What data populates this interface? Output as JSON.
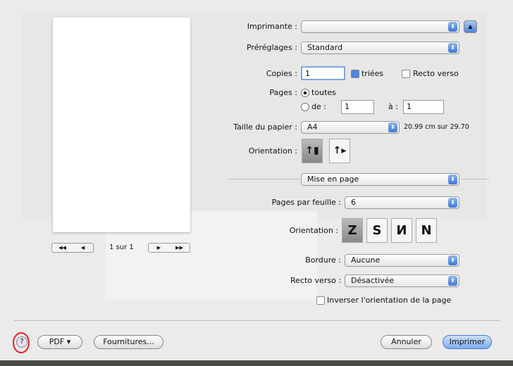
{
  "printer": {
    "label": "Imprimante :",
    "value": ""
  },
  "presets": {
    "label": "Préréglages :",
    "value": "Standard"
  },
  "copies": {
    "label": "Copies :",
    "value": "1",
    "collated_label": "triées",
    "collated": true,
    "duplex_label": "Recto verso",
    "duplex": false
  },
  "pages": {
    "label": "Pages :",
    "all_label": "toutes",
    "range_label": "de :",
    "from": "1",
    "to_label": "à :",
    "to": "1",
    "selected": "toutes"
  },
  "paper": {
    "label": "Taille du papier :",
    "value": "A4",
    "size_text": "20.99 cm sur 29.70"
  },
  "orientation": {
    "label": "Orientation :",
    "options": [
      "portrait",
      "landscape"
    ],
    "selected": "portrait"
  },
  "section": {
    "value": "Mise en page"
  },
  "layout": {
    "pages_per_sheet_label": "Pages par feuille :",
    "pages_per_sheet": "6",
    "direction_label": "Orientation :",
    "directions": [
      "Z",
      "S",
      "N",
      "N"
    ],
    "selected": 0,
    "border_label": "Bordure :",
    "border": "Aucune",
    "duplex_label": "Recto verso :",
    "duplex": "Désactivée",
    "reverse_label": "Inverser l'orientation de la page",
    "reverse": false
  },
  "preview": {
    "first": "◀◀",
    "prev": "◀",
    "page_text": "1 sur 1",
    "next": "▶",
    "last": "▶▶"
  },
  "footer": {
    "help": "?",
    "pdf": "PDF ▾",
    "supplies": "Fournitures...",
    "cancel": "Annuler",
    "print": "Imprimer"
  },
  "colors": {
    "accent": "#3d79d8",
    "highlight": "#e0202a"
  }
}
